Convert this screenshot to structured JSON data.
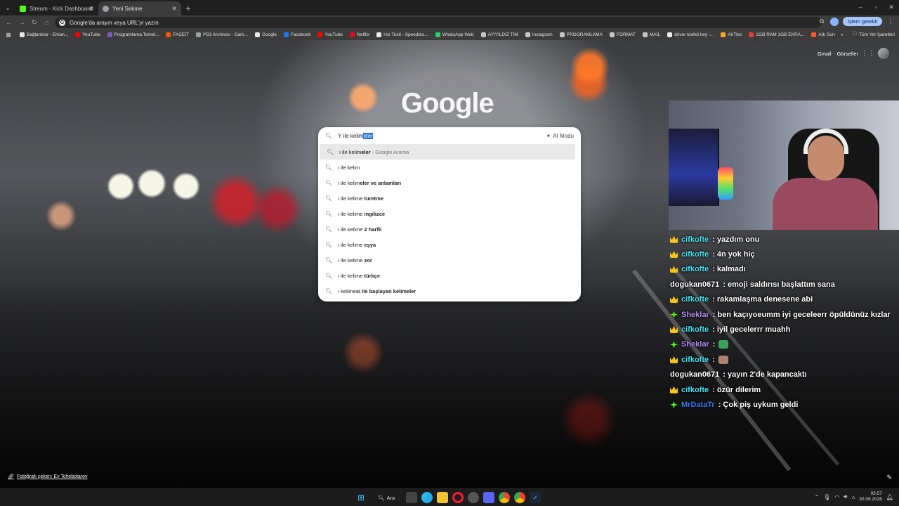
{
  "browser": {
    "tabs": [
      {
        "label": "Stream - Kick Dashboard",
        "favicon_color": "#53fc18",
        "active": false
      },
      {
        "label": "Yeni Sekme",
        "favicon_color": "#9aa0a6",
        "active": true
      }
    ],
    "omnibox_placeholder": "Google'da arayın veya URL'yi yazın",
    "update_label": "İşlem gerekli",
    "bookmarks": [
      {
        "label": "Bağlantılar - Erkan...",
        "color": "#e8eaed"
      },
      {
        "label": "YouTube",
        "color": "#ff0000"
      },
      {
        "label": "Programlama Temel...",
        "color": "#7e57c2"
      },
      {
        "label": "FACEIT",
        "color": "#ff5500"
      },
      {
        "label": "PS3 Archives - Gam...",
        "color": "#9aa0a6"
      },
      {
        "label": "Google",
        "color": "#e8eaed"
      },
      {
        "label": "Facebook",
        "color": "#1877f2"
      },
      {
        "label": "YouTube",
        "color": "#ff0000"
      },
      {
        "label": "Netflix",
        "color": "#e50914"
      },
      {
        "label": "Hız Testi - Speedtes...",
        "color": "#e8eaed"
      },
      {
        "label": "WhatsApp Web",
        "color": "#25d366"
      },
      {
        "label": "AYIYILDIZ TİM",
        "color": "#c4c7c5"
      },
      {
        "label": "Instagram",
        "color": "#c4c7c5"
      },
      {
        "label": "PROGRAMLAMA",
        "color": "#c4c7c5"
      },
      {
        "label": "FORMAT",
        "color": "#c4c7c5"
      },
      {
        "label": "MAİL",
        "color": "#c4c7c5"
      },
      {
        "label": "driver toolkit key -...",
        "color": "#e8eaed"
      },
      {
        "label": "AirTies",
        "color": "#f5a623"
      },
      {
        "label": "2GB RAM 1GB EKRA...",
        "color": "#e53935"
      },
      {
        "label": "Ark Survival Evolved...",
        "color": "#ff5722"
      }
    ],
    "all_bookmarks_label": "Tüm Yer İşaretleri"
  },
  "page": {
    "gmail_label": "Gmail",
    "images_label": "Görseller",
    "logo_text": "Google",
    "photo_credit": "Fotoğrafı çeken: Ev Tchebotarev"
  },
  "search": {
    "typed": "Y ile kelim",
    "selected_completion": "eler",
    "ai_mode_label": "AI Modu",
    "suggestions": [
      {
        "prefix": "ı ile kelim",
        "bold": "eler",
        "meta": " - Google Arama",
        "highlight": true
      },
      {
        "prefix": "ı ile kelim",
        "bold": "",
        "meta": "",
        "highlight": false
      },
      {
        "prefix": "ı ile kelim",
        "bold": "eler ve anlamları",
        "meta": "",
        "highlight": false
      },
      {
        "prefix": "ı ile kelime ",
        "bold": "türetme",
        "meta": "",
        "highlight": false
      },
      {
        "prefix": "ı ile kelime ",
        "bold": "ingilizce",
        "meta": "",
        "highlight": false
      },
      {
        "prefix": "ı ile kelime ",
        "bold": "2 harfli",
        "meta": "",
        "highlight": false
      },
      {
        "prefix": "ı ile kelime ",
        "bold": "eşya",
        "meta": "",
        "highlight": false
      },
      {
        "prefix": "ı ile kelime ",
        "bold": "zor",
        "meta": "",
        "highlight": false
      },
      {
        "prefix": "ı ile kelime ",
        "bold": "türkçe",
        "meta": "",
        "highlight": false
      },
      {
        "prefix": "ı kelime",
        "bold": "si ile başlayan kelimeler",
        "meta": "",
        "highlight": false
      }
    ]
  },
  "chat": [
    {
      "badge": "crown",
      "user": "cifkofte",
      "color": "#4ee0f0",
      "text": ": yazdım onu"
    },
    {
      "badge": "crown",
      "user": "cifkofte",
      "color": "#4ee0f0",
      "text": ": 4n yok hiç"
    },
    {
      "badge": "crown",
      "user": "cifkofte",
      "color": "#4ee0f0",
      "text": ": kalmadı"
    },
    {
      "badge": "",
      "user": "dogukan0671",
      "color": "#ffffff",
      "text": ": emoji saldırısı başlattım sana"
    },
    {
      "badge": "crown",
      "user": "cifkofte",
      "color": "#4ee0f0",
      "text": ": rakamlaşma denesene abi"
    },
    {
      "badge": "star",
      "user": "Sheklar",
      "color": "#b58cf0",
      "text": ": ben kaçıyoeumm iyi geceleerr öpüldünüz kızlar"
    },
    {
      "badge": "crown",
      "user": "cifkofte",
      "color": "#4ee0f0",
      "text": ": iyil gecelerrr muahh"
    },
    {
      "badge": "star",
      "user": "Sheklar",
      "color": "#b58cf0",
      "text": ":",
      "emote": "#3aa05a"
    },
    {
      "badge": "crown",
      "user": "cifkofte",
      "color": "#4ee0f0",
      "text": ":",
      "emote": "#b08070"
    },
    {
      "badge": "",
      "user": "dogukan0671",
      "color": "#ffffff",
      "text": ": yayın 2'de kapancaktı"
    },
    {
      "badge": "crown",
      "user": "cifkofte",
      "color": "#4ee0f0",
      "text": ": özür dilerim"
    },
    {
      "badge": "star",
      "user": "MrDataTr",
      "color": "#3a7bf0",
      "text": ": Çok piş uykum geldi"
    }
  ],
  "taskbar": {
    "search_label": "Ara",
    "time": "03:57",
    "date": "30.08.2026"
  }
}
